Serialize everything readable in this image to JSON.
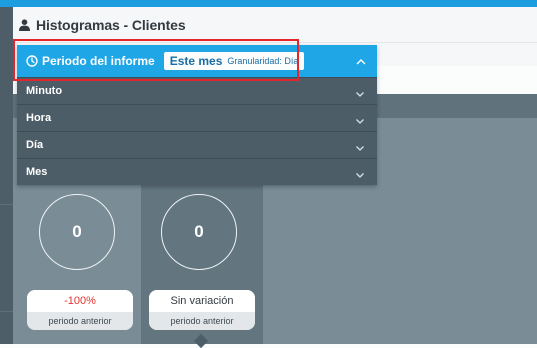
{
  "page": {
    "title": "Histogramas - Clientes"
  },
  "dropdown": {
    "title": "Periodo del informe",
    "selected_value": "Este mes",
    "granularity": "Granularidad: Día",
    "options": [
      "Minuto",
      "Hora",
      "Día",
      "Mes"
    ]
  },
  "cards": [
    {
      "value": "0",
      "change": "-100%",
      "caption": "periodo anterior"
    },
    {
      "value": "0",
      "change": "Sin variación",
      "caption": "periodo anterior"
    }
  ],
  "colors": {
    "accent": "#1ea6e6",
    "menu_bg": "#4d5d67",
    "highlight": "#e4252c",
    "negative": "#e3342f"
  },
  "icons": [
    "user-icon",
    "clock-icon",
    "chevron-up-icon",
    "chevron-down-icon"
  ]
}
